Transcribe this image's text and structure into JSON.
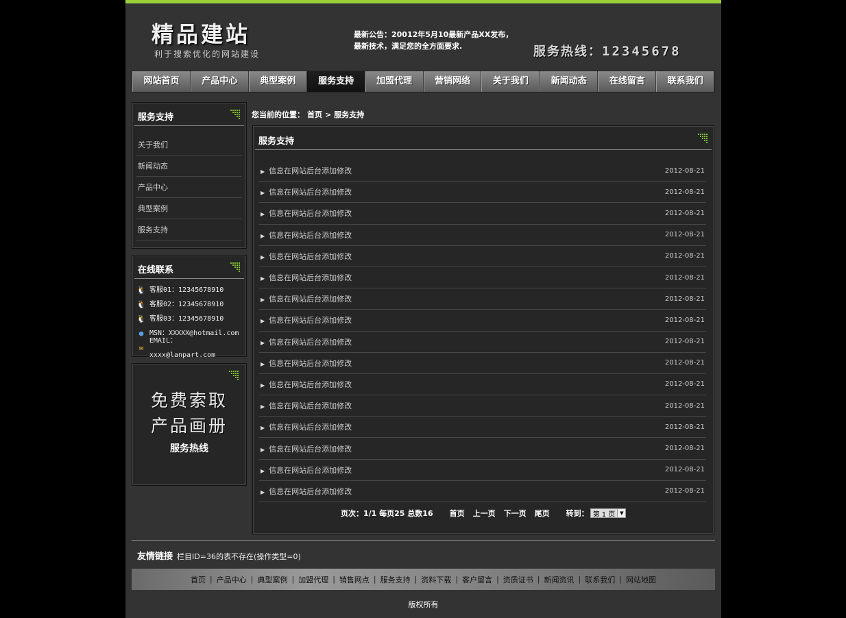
{
  "header": {
    "logo_title": "精品建站",
    "logo_sub": "利于搜索优化的网站建设",
    "notice_line1": "最新公告：20012年5月10最新产品XX发布，",
    "notice_line2": "最新技术，满足您的全方面要求.",
    "hotline_label": "服务热线：",
    "hotline_number": "12345678"
  },
  "nav": {
    "items": [
      "网站首页",
      "产品中心",
      "典型案例",
      "服务支持",
      "加盟代理",
      "营销网络",
      "关于我们",
      "新闻动态",
      "在线留言",
      "联系我们"
    ],
    "active": "服务支持"
  },
  "sidebar": {
    "menu_title": "服务支持",
    "menu_items": [
      "关于我们",
      "新闻动态",
      "产品中心",
      "典型案例",
      "服务支持"
    ],
    "contact_title": "在线联系",
    "contacts": [
      {
        "icon": "qq-icon",
        "text": "客服01：12345678910"
      },
      {
        "icon": "qq-icon",
        "text": "客服02：12345678910"
      },
      {
        "icon": "qq-icon",
        "text": "客服03：12345678910"
      },
      {
        "icon": "msn-icon",
        "text": "MSN：XXXXX@hotmail.com"
      },
      {
        "icon": "email-icon",
        "text": "EMAIL：xxxx@lanpart.com"
      }
    ],
    "promo_line1": "免费索取",
    "promo_line2": "产品画册",
    "promo_line3": "服务热线"
  },
  "breadcrumb": {
    "prefix": "您当前的位置：",
    "home": "首页",
    "separator": ">",
    "current": "服务支持"
  },
  "main": {
    "title": "服务支持",
    "items": [
      {
        "title": "信息在网站后台添加修改",
        "date": "2012-08-21"
      },
      {
        "title": "信息在网站后台添加修改",
        "date": "2012-08-21"
      },
      {
        "title": "信息在网站后台添加修改",
        "date": "2012-08-21"
      },
      {
        "title": "信息在网站后台添加修改",
        "date": "2012-08-21"
      },
      {
        "title": "信息在网站后台添加修改",
        "date": "2012-08-21"
      },
      {
        "title": "信息在网站后台添加修改",
        "date": "2012-08-21"
      },
      {
        "title": "信息在网站后台添加修改",
        "date": "2012-08-21"
      },
      {
        "title": "信息在网站后台添加修改",
        "date": "2012-08-21"
      },
      {
        "title": "信息在网站后台添加修改",
        "date": "2012-08-21"
      },
      {
        "title": "信息在网站后台添加修改",
        "date": "2012-08-21"
      },
      {
        "title": "信息在网站后台添加修改",
        "date": "2012-08-21"
      },
      {
        "title": "信息在网站后台添加修改",
        "date": "2012-08-21"
      },
      {
        "title": "信息在网站后台添加修改",
        "date": "2012-08-21"
      },
      {
        "title": "信息在网站后台添加修改",
        "date": "2012-08-21"
      },
      {
        "title": "信息在网站后台添加修改",
        "date": "2012-08-21"
      },
      {
        "title": "信息在网站后台添加修改",
        "date": "2012-08-21"
      }
    ]
  },
  "pager": {
    "info": "页次：1/1 每页25 总数16",
    "first": "首页",
    "prev": "上一页",
    "next": "下一页",
    "last": "尾页",
    "goto_label": "转到：",
    "goto_value": "第 1 页"
  },
  "footer": {
    "links_title": "友情链接",
    "links_text": "栏目ID=36的表不存在(操作类型=0)",
    "nav": [
      "首页",
      "产品中心",
      "典型案例",
      "加盟代理",
      "销售网点",
      "服务支持",
      "资料下载",
      "客户留言",
      "资质证书",
      "新闻资讯",
      "联系我们",
      "网站地图"
    ],
    "copyright": "版权所有"
  },
  "colors": {
    "accent_top_bar": "#9ad13a",
    "page_bg": "#333333",
    "corner_green": "#7cb82f"
  }
}
